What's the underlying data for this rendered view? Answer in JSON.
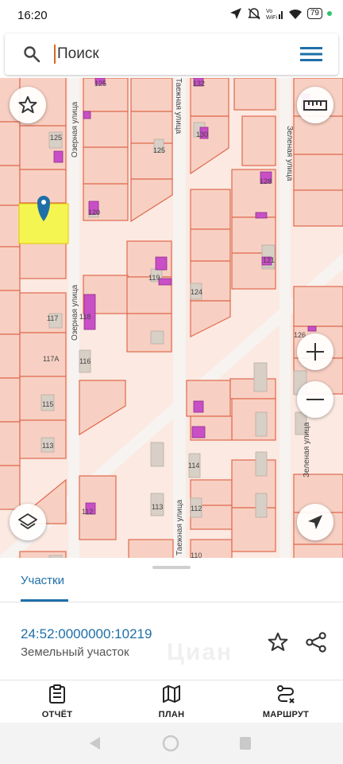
{
  "status_bar": {
    "time": "16:20",
    "battery": "79",
    "icons": [
      "location-arrow-icon",
      "do-not-disturb-icon",
      "vowifi-icon",
      "wifi-icon",
      "battery-icon",
      "notification-dot-icon"
    ]
  },
  "search": {
    "placeholder": "Поиск",
    "value": ""
  },
  "map": {
    "street_labels": [
      "Озерная улица",
      "Озерная улица",
      "Таежная улица",
      "Таежная улица",
      "Зеленая улица",
      "Зеленая улица"
    ],
    "house_numbers": [
      "125",
      "125",
      "125",
      "132",
      "130",
      "128",
      "121",
      "120",
      "119",
      "124",
      "117",
      "118",
      "126",
      "117А",
      "116",
      "115",
      "113",
      "114",
      "113",
      "112",
      "112",
      "110"
    ],
    "colors": {
      "parcel_fill": "#f7d0c3",
      "parcel_border": "#e06a4e",
      "selected_parcel": "#f5f552",
      "building": "#c94fc6",
      "pin": "#1f6fa8"
    },
    "controls": [
      "favorite-star-icon",
      "ruler-icon",
      "layers-icon",
      "zoom-in-icon",
      "zoom-out-icon",
      "navigation-arrow-icon"
    ]
  },
  "bottom_sheet": {
    "tab_label": "Участки",
    "parcel_number": "24:52:0000000:10219",
    "parcel_type": "Земельный участок",
    "watermark": "Циан"
  },
  "actions": [
    {
      "label": "ОТЧЁТ",
      "icon": "clipboard-icon"
    },
    {
      "label": "ПЛАН",
      "icon": "map-icon"
    },
    {
      "label": "МАРШРУТ",
      "icon": "route-icon"
    }
  ],
  "nav_bar": {
    "icons": [
      "back-icon",
      "home-icon",
      "recents-icon"
    ]
  }
}
